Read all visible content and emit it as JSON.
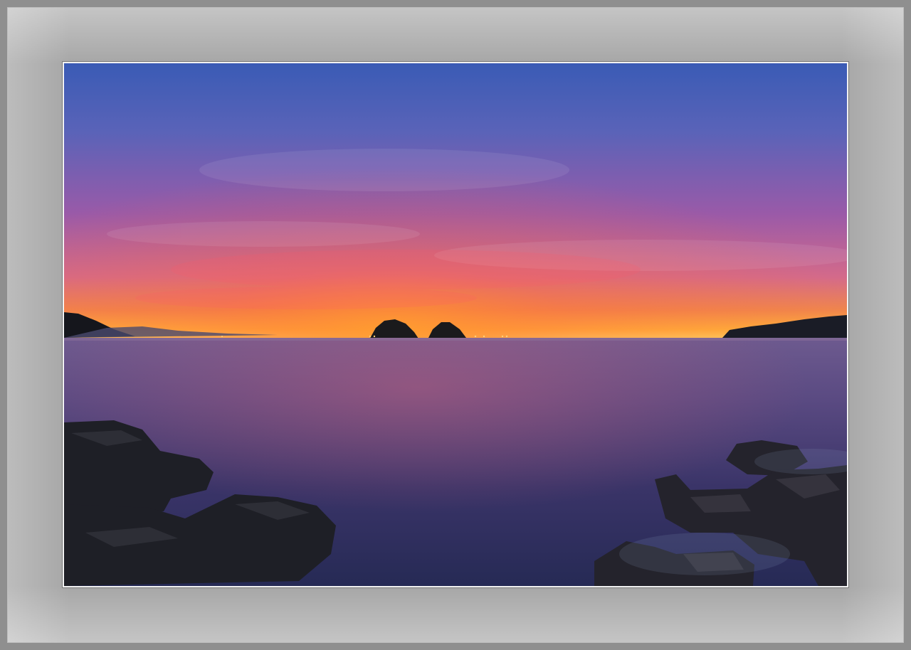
{
  "image": {
    "subject": "sunset-seascape",
    "colors": {
      "mat": "#a6a6a6",
      "sky_top": "#3f63b8",
      "sky_mid": "#6b4f9e",
      "sky_glow": "#ff7a2a",
      "horizon": "#ffb23a",
      "sea": "#3b3566",
      "rock": "#1c1d24"
    }
  }
}
